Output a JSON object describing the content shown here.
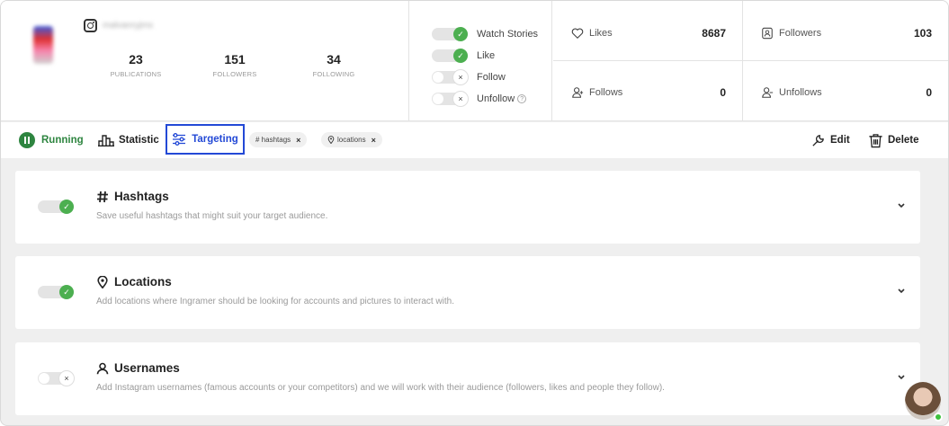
{
  "profile": {
    "handle": "malvanryjms",
    "stats": [
      {
        "value": "23",
        "label": "PUBLICATIONS"
      },
      {
        "value": "151",
        "label": "FOLLOWERS"
      },
      {
        "value": "34",
        "label": "FOLLOWING"
      }
    ]
  },
  "toggles": [
    {
      "label": "Watch Stories",
      "on": true
    },
    {
      "label": "Like",
      "on": true
    },
    {
      "label": "Follow",
      "on": false
    },
    {
      "label": "Unfollow",
      "on": false,
      "help": "?"
    }
  ],
  "metrics": {
    "likes": {
      "label": "Likes",
      "value": "8687"
    },
    "followers": {
      "label": "Followers",
      "value": "103"
    },
    "follows": {
      "label": "Follows",
      "value": "0"
    },
    "unfollows": {
      "label": "Unfollows",
      "value": "0"
    }
  },
  "toolbar": {
    "running": "Running",
    "statistic": "Statistic",
    "targeting": "Targeting",
    "chips": [
      {
        "label": "# hashtags",
        "remove": "×"
      },
      {
        "label": "locations",
        "remove": "×"
      }
    ],
    "edit": "Edit",
    "delete": "Delete"
  },
  "cards": [
    {
      "title": "Hashtags",
      "icon": "hash-icon",
      "on": true,
      "desc": "Save useful hashtags that might suit your target audience."
    },
    {
      "title": "Locations",
      "icon": "location-pin-icon",
      "on": true,
      "desc": "Add locations where Ingramer should be looking for accounts and pictures to interact with."
    },
    {
      "title": "Usernames",
      "icon": "user-icon",
      "on": false,
      "desc": "Add Instagram usernames (famous accounts or your competitors) and we will work with their audience (followers, likes and people they follow)."
    }
  ],
  "switch_glyphs": {
    "on": "✓",
    "off": "×"
  },
  "colors": {
    "accent_green": "#2e8540",
    "toggle_green": "#4caf50",
    "selected_blue": "#2349d6"
  }
}
